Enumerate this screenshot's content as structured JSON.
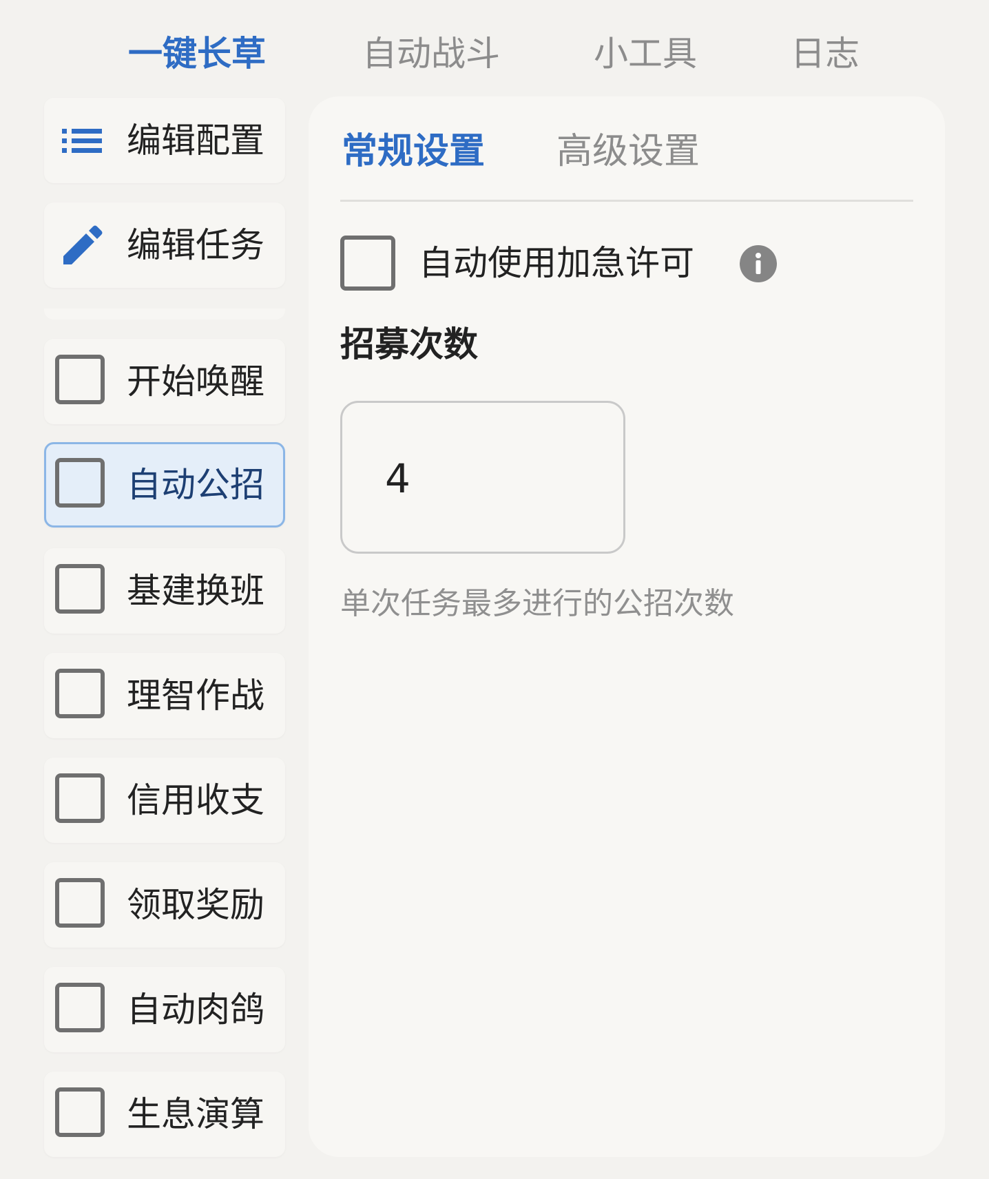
{
  "top_nav": {
    "tabs": [
      {
        "label": "一键长草",
        "active": true
      },
      {
        "label": "自动战斗",
        "active": false
      },
      {
        "label": "小工具",
        "active": false
      },
      {
        "label": "日志",
        "active": false
      }
    ]
  },
  "sidebar": {
    "actions": [
      {
        "label": "编辑配置",
        "icon": "list-icon"
      },
      {
        "label": "编辑任务",
        "icon": "pencil-icon"
      }
    ],
    "tasks": [
      {
        "label": "开始唤醒",
        "checked": false,
        "selected": false
      },
      {
        "label": "自动公招",
        "checked": false,
        "selected": true
      },
      {
        "label": "基建换班",
        "checked": false,
        "selected": false
      },
      {
        "label": "理智作战",
        "checked": false,
        "selected": false
      },
      {
        "label": "信用收支",
        "checked": false,
        "selected": false
      },
      {
        "label": "领取奖励",
        "checked": false,
        "selected": false
      },
      {
        "label": "自动肉鸽",
        "checked": false,
        "selected": false
      },
      {
        "label": "生息演算",
        "checked": false,
        "selected": false
      }
    ]
  },
  "main": {
    "sub_tabs": [
      {
        "label": "常规设置",
        "active": true
      },
      {
        "label": "高级设置",
        "active": false
      }
    ],
    "urgent_permit": {
      "label": "自动使用加急许可",
      "checked": false
    },
    "recruit_count": {
      "title": "招募次数",
      "value": "4",
      "helper": "单次任务最多进行的公招次数"
    }
  },
  "colors": {
    "accent": "#2e6cc4",
    "selected_bg": "#e4eef9",
    "selected_border": "#8bb6e6",
    "muted_text": "#8c8c8c",
    "page_bg": "#f3f2ef"
  }
}
